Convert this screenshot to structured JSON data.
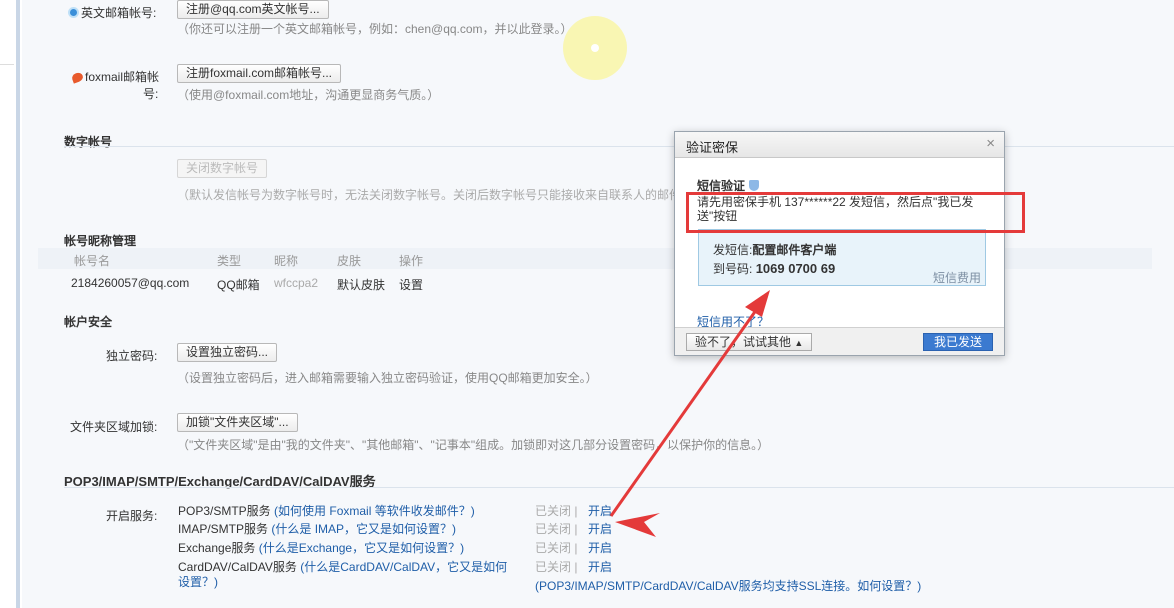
{
  "account": {
    "english_label": "英文邮箱帐号:",
    "english_button": "注册@qq.com英文帐号...",
    "english_hint": "（你还可以注册一个英文邮箱帐号，例如：chen@qq.com，并以此登录。）",
    "foxmail_label_line1": "foxmail邮箱帐",
    "foxmail_label_line2": "号:",
    "foxmail_button": "注册foxmail.com邮箱帐号...",
    "foxmail_hint": "（使用@foxmail.com地址，沟通更显商务气质。）"
  },
  "numeric": {
    "title": "数字帐号",
    "button": "关闭数字帐号",
    "hint": "（默认发信帐号为数字帐号时，无法关闭数字帐号。关闭后数字帐号只能接收来自联系人的邮件"
  },
  "nickname": {
    "title": "帐号昵称管理",
    "headers": [
      "帐号名",
      "类型",
      "昵称",
      "皮肤",
      "操作"
    ],
    "row": {
      "account": "2184260057@qq.com",
      "type": "QQ邮箱",
      "nickname": "wfccpa2",
      "skin": "默认皮肤",
      "action": "设置"
    }
  },
  "security": {
    "title": "帐户安全",
    "password_label": "独立密码:",
    "password_button": "设置独立密码...",
    "password_hint": "（设置独立密码后，进入邮箱需要输入独立密码验证，使用QQ邮箱更加安全。）",
    "folder_label": "文件夹区域加锁:",
    "folder_button": "加锁\"文件夹区域\"...",
    "folder_hint": "（\"文件夹区域\"是由\"我的文件夹\"、\"其他邮箱\"、\"记事本\"组成。加锁即对这几部分设置密码，以保护你的信息。）"
  },
  "services": {
    "title": "POP3/IMAP/SMTP/Exchange/CardDAV/CalDAV服务",
    "label": "开启服务:",
    "items": [
      {
        "name": "POP3/SMTP服务",
        "help": "(如何使用 Foxmail 等软件收发邮件？)",
        "status": "已关闭",
        "sep": "|",
        "action": "开启"
      },
      {
        "name": "IMAP/SMTP服务",
        "help": "(什么是 IMAP，它又是如何设置？)",
        "status": "已关闭",
        "sep": "|",
        "action": "开启"
      },
      {
        "name": "Exchange服务",
        "help": "(什么是Exchange，它又是如何设置？)",
        "status": "已关闭",
        "sep": "|",
        "action": "开启"
      },
      {
        "name": "CardDAV/CalDAV服务",
        "help": "(什么是CardDAV/CalDAV，它又是如何",
        "help2": "设置？)",
        "status": "已关闭",
        "sep": "|",
        "action": "开启"
      }
    ],
    "ssl_note": "(POP3/IMAP/SMTP/CardDAV/CalDAV服务均支持SSL连接。如何设置？)"
  },
  "dialog": {
    "title": "验证密保",
    "close": "×",
    "subtitle": "短信验证",
    "description": "请先用密保手机 137******22 发短信，然后点\"我已发送\"按钮",
    "sms_label": "发短信:",
    "sms_content": "配置邮件客户端",
    "to_label": "到号码:",
    "to_number": "1069 0700 69",
    "fee": "短信费用",
    "unavailable": "短信用不了？",
    "try_other": "验不了，试试其他",
    "caret": "▲",
    "send_button": "我已发送"
  },
  "colors": {
    "annotation": "#e43a3a",
    "link": "#1f5ea8",
    "primary_button": "#3b7ad0"
  }
}
